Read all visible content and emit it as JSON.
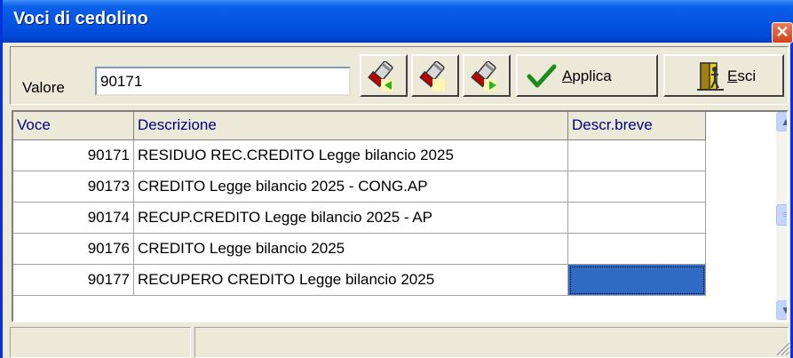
{
  "window": {
    "title": "Voci di cedolino",
    "close_glyph": "✕"
  },
  "toolbar": {
    "valore_label": "Valore",
    "valore_value": "90171",
    "buttons": [
      {
        "icon": "flashlight-prev-icon"
      },
      {
        "icon": "flashlight-icon"
      },
      {
        "icon": "flashlight-next-icon"
      }
    ],
    "applica": {
      "icon": "checkmark-icon",
      "accel": "A",
      "rest": "pplica"
    },
    "esci": {
      "icon": "exit-door-icon",
      "accel": "E",
      "rest": "sci"
    }
  },
  "grid": {
    "columns": [
      "Voce",
      "Descrizione",
      "Descr.breve"
    ],
    "rows": [
      {
        "voce": "90171",
        "descrizione": "RESIDUO REC.CREDITO Legge bilancio 2025",
        "breve": ""
      },
      {
        "voce": "90173",
        "descrizione": "CREDITO Legge bilancio 2025 - CONG.AP",
        "breve": ""
      },
      {
        "voce": "90174",
        "descrizione": "RECUP.CREDITO Legge bilancio 2025 - AP",
        "breve": ""
      },
      {
        "voce": "90176",
        "descrizione": "CREDITO Legge bilancio 2025",
        "breve": ""
      },
      {
        "voce": "90177",
        "descrizione": "RECUPERO CREDITO Legge bilancio 2025",
        "breve": ""
      }
    ],
    "selected_row": 4,
    "selected_column": "Descr.breve"
  },
  "colors": {
    "title_bar": "#0454E3",
    "header_text": "#000080",
    "selection": "#316AC5",
    "face": "#ECE9D8"
  }
}
